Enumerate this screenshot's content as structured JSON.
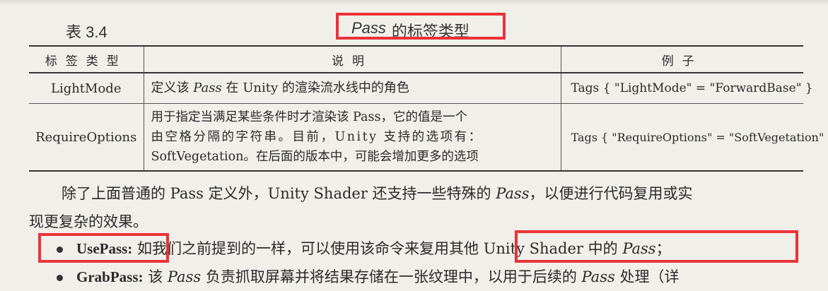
{
  "caption": {
    "number": "表 3.4",
    "title_italic": "Pass",
    "title_rest": "的标签类型"
  },
  "table": {
    "headers": [
      "标签类型",
      "说明",
      "例子"
    ],
    "rows": [
      {
        "tag": "LightMode",
        "desc_pre": "定义该 ",
        "desc_it": "Pass",
        "desc_post": " 在 Unity 的渲染流水线中的角色",
        "example": "Tags { \"LightMode\" = \"ForwardBase\" }"
      },
      {
        "tag": "RequireOptions",
        "desc_lines": [
          "用于指定当满足某些条件时才渲染该 Pass，它的值是一个",
          "由空格分隔的字符串。目前，Unity 支持的选项有：",
          "SoftVegetation。在后面的版本中，可能会增加更多的选项"
        ],
        "example": "Tags { \"RequireOptions\" = \"SoftVegetation\" }"
      }
    ]
  },
  "paragraph": {
    "part1": "除了上面普通的 Pass 定义外，Unity Shader 还支持一些特殊的 ",
    "part_it": "Pass",
    "part2": "，以便进行代码复用或实",
    "line2": "现更复杂的效果。"
  },
  "bullets": [
    {
      "term": "UsePass",
      "colon": ":",
      "text1": " 如我们之前提到的一样，可以使用该命令来复用其他 Unity Shader 中的 ",
      "text_it": "Pass",
      "text2": "；"
    },
    {
      "term": "GrabPass",
      "colon": ":",
      "text1": " 该 ",
      "text_it": "Pass",
      "text2": " 负责抓取屏幕并将结果存储在一张纹理中，以用于后续的 ",
      "text_it2": "Pass",
      "text3": " 处理（详"
    }
  ],
  "highlight_color": "#ea3339"
}
